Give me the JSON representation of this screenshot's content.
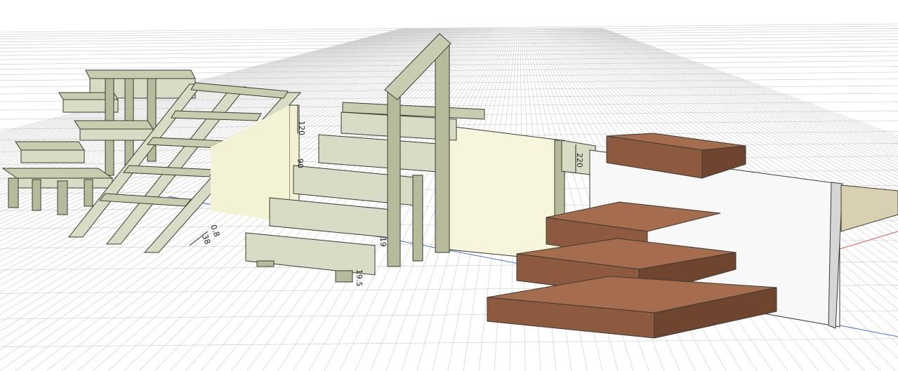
{
  "scene": {
    "colors": {
      "background": "#ffffff",
      "grid_line": "#c9c9c9",
      "grid_minor": "#e2e2e2",
      "axis_x": "#e05050",
      "axis_y": "#4a6fd8",
      "wood_light": "#d9dcc4",
      "wood_light_top": "#c9cdb0",
      "wood_light_dark": "#b7bb9c",
      "wood_dark": "#8e5a3f",
      "wood_dark_top": "#a56c4e",
      "wood_dark_side": "#6f4530",
      "panel_cream": "#f7f6dc",
      "panel_white": "#f8f8f8",
      "outline": "#3b3b32"
    },
    "dimensions": {
      "d1": "120",
      "d2": "90",
      "d3": "220",
      "d4": "0.8",
      "d5": "38",
      "d6": "19",
      "d7": "19.5"
    }
  }
}
